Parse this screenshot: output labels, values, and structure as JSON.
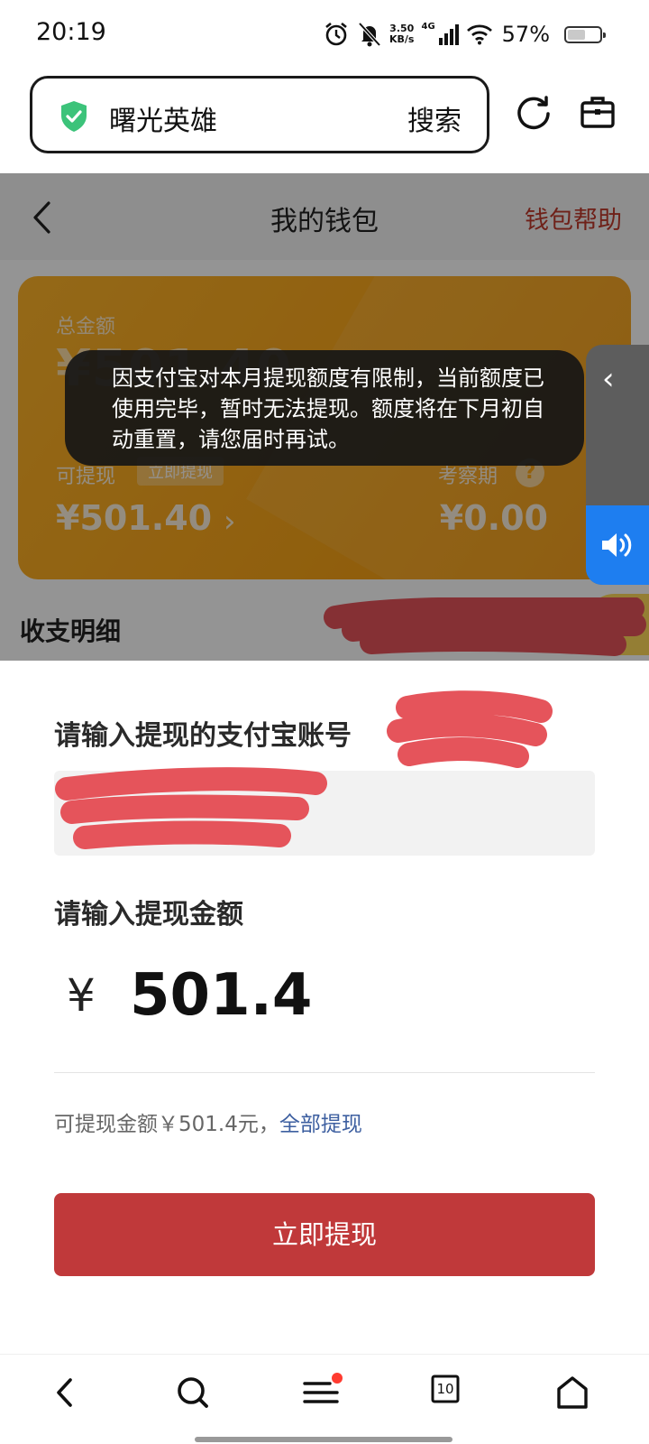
{
  "status_bar": {
    "time": "20:19",
    "net_speed_value": "3.50",
    "net_speed_unit": "KB/s",
    "network_type": "4G",
    "battery_percent": "57%",
    "battery_level": 0.57
  },
  "browser": {
    "url_text": "曙光英雄",
    "search_label": "搜索",
    "secure_icon": "shield-check-icon",
    "refresh_icon": "refresh-icon",
    "toolbox_icon": "toolbox-icon"
  },
  "wallet_page": {
    "title": "我的钱包",
    "help_link": "钱包帮助",
    "card": {
      "total_label": "总金额",
      "total_amount": "¥501.40",
      "withdrawable_label": "可提现",
      "withdraw_now_chip": "立即提现",
      "withdrawable_amount": "¥501.40",
      "review_label": "考察期",
      "review_help": "?",
      "review_amount": "¥0.00",
      "color_from": "#ffb42a",
      "color_to": "#f59a0c"
    },
    "details_title": "收支明细"
  },
  "toast": {
    "message": "因支付宝对本月提现额度有限制，当前额度已使用完毕，暂时无法提现。额度将在下月初自动重置，请您届时再试。"
  },
  "side_widget": {
    "collapse_glyph": "‹",
    "speaker_icon": "speaker-icon"
  },
  "sheet": {
    "account_label": "请输入提现的支付宝账号",
    "amount_label": "请输入提现金额",
    "currency_symbol": "¥",
    "amount_value": "501.4",
    "available_prefix": "可提现金额￥501.4元，",
    "withdraw_all_link": "全部提现",
    "submit_label": "立即提现",
    "submit_color": "#c0393a"
  },
  "nav": {
    "tab_count": "10",
    "items": [
      "back-icon",
      "search-icon",
      "menu-icon",
      "tabs-icon",
      "home-icon"
    ]
  }
}
